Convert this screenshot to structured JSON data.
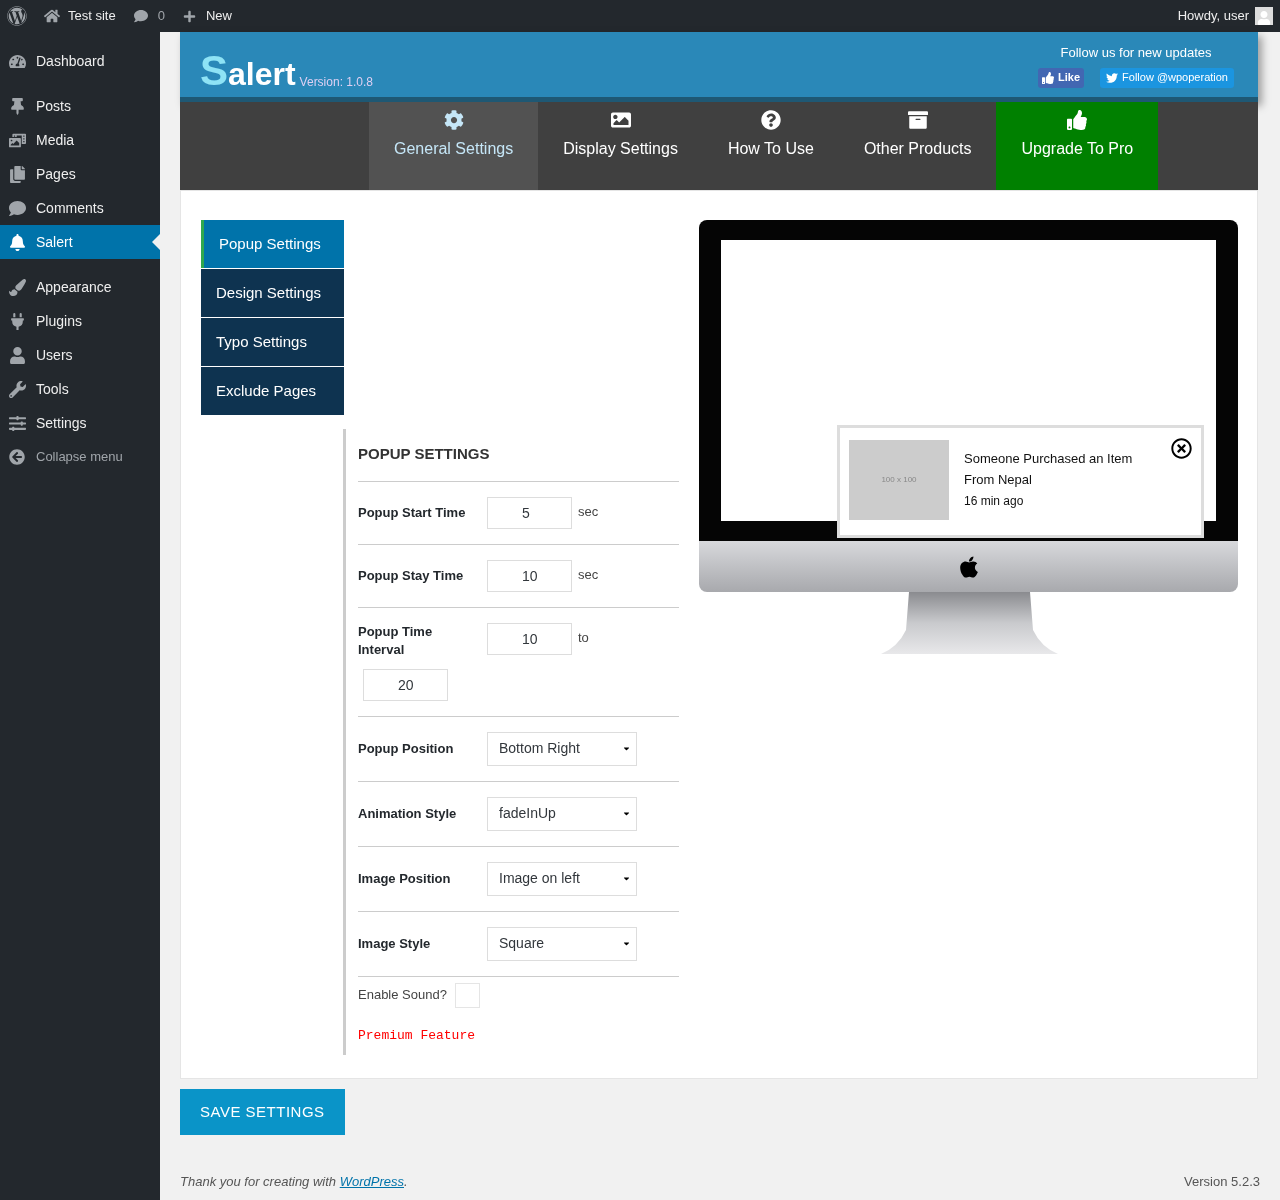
{
  "admin_bar": {
    "site": "Test site",
    "comments": "0",
    "new": "New",
    "greeting": "Howdy, user"
  },
  "sidebar": {
    "items": [
      {
        "label": "Dashboard",
        "selected": false
      },
      {
        "label": "Posts",
        "selected": false
      },
      {
        "label": "Media",
        "selected": false
      },
      {
        "label": "Pages",
        "selected": false
      },
      {
        "label": "Comments",
        "selected": false
      },
      {
        "label": "Salert",
        "selected": true
      },
      {
        "label": "Appearance",
        "selected": false
      },
      {
        "label": "Plugins",
        "selected": false
      },
      {
        "label": "Users",
        "selected": false
      },
      {
        "label": "Tools",
        "selected": false
      },
      {
        "label": "Settings",
        "selected": false
      }
    ],
    "collapse": "Collapse menu"
  },
  "header": {
    "logo": {
      "initial": "S",
      "rest": "alert"
    },
    "version": "Version: 1.0.8",
    "follow_text": "Follow us for new updates",
    "like": "Like",
    "follow": "Follow @wpoperation"
  },
  "tabs": [
    {
      "label": "General Settings",
      "selected": true,
      "kind": "normal"
    },
    {
      "label": "Display Settings",
      "selected": false,
      "kind": "normal"
    },
    {
      "label": "How To Use",
      "selected": false,
      "kind": "normal"
    },
    {
      "label": "Other Products",
      "selected": false,
      "kind": "normal"
    },
    {
      "label": "Upgrade To Pro",
      "selected": false,
      "kind": "upgrade"
    }
  ],
  "subtabs": [
    {
      "label": "Popup Settings",
      "selected": true
    },
    {
      "label": "Design Settings",
      "selected": false
    },
    {
      "label": "Typo Settings",
      "selected": false
    },
    {
      "label": "Exclude Pages",
      "selected": false
    }
  ],
  "form": {
    "title": "POPUP SETTINGS",
    "fields": [
      {
        "kind": "number",
        "label": "Popup Start Time",
        "value": "5",
        "suffix": "sec"
      },
      {
        "kind": "number",
        "label": "Popup Stay Time",
        "value": "10",
        "suffix": "sec"
      },
      {
        "kind": "range",
        "label": "Popup Time Interval",
        "value": "10",
        "suffix": "to",
        "value2": "20"
      },
      {
        "kind": "select",
        "label": "Popup Position",
        "value": "Bottom Right"
      },
      {
        "kind": "select",
        "label": "Animation Style",
        "value": "fadeInUp"
      },
      {
        "kind": "select",
        "label": "Image Position",
        "value": "Image on left"
      },
      {
        "kind": "select",
        "label": "Image Style",
        "value": "Square"
      }
    ],
    "sound": {
      "label": "Enable Sound?",
      "checked": false
    },
    "premium": "Premium Feature"
  },
  "preview": {
    "image_text": "100 x 100",
    "title": "Someone Purchased an Item From Nepal",
    "time": "16 min ago"
  },
  "save": "SAVE SETTINGS",
  "footer": {
    "text": "Thank you for creating with ",
    "link": "WordPress",
    "after": ".",
    "version": "Version 5.2.3"
  }
}
